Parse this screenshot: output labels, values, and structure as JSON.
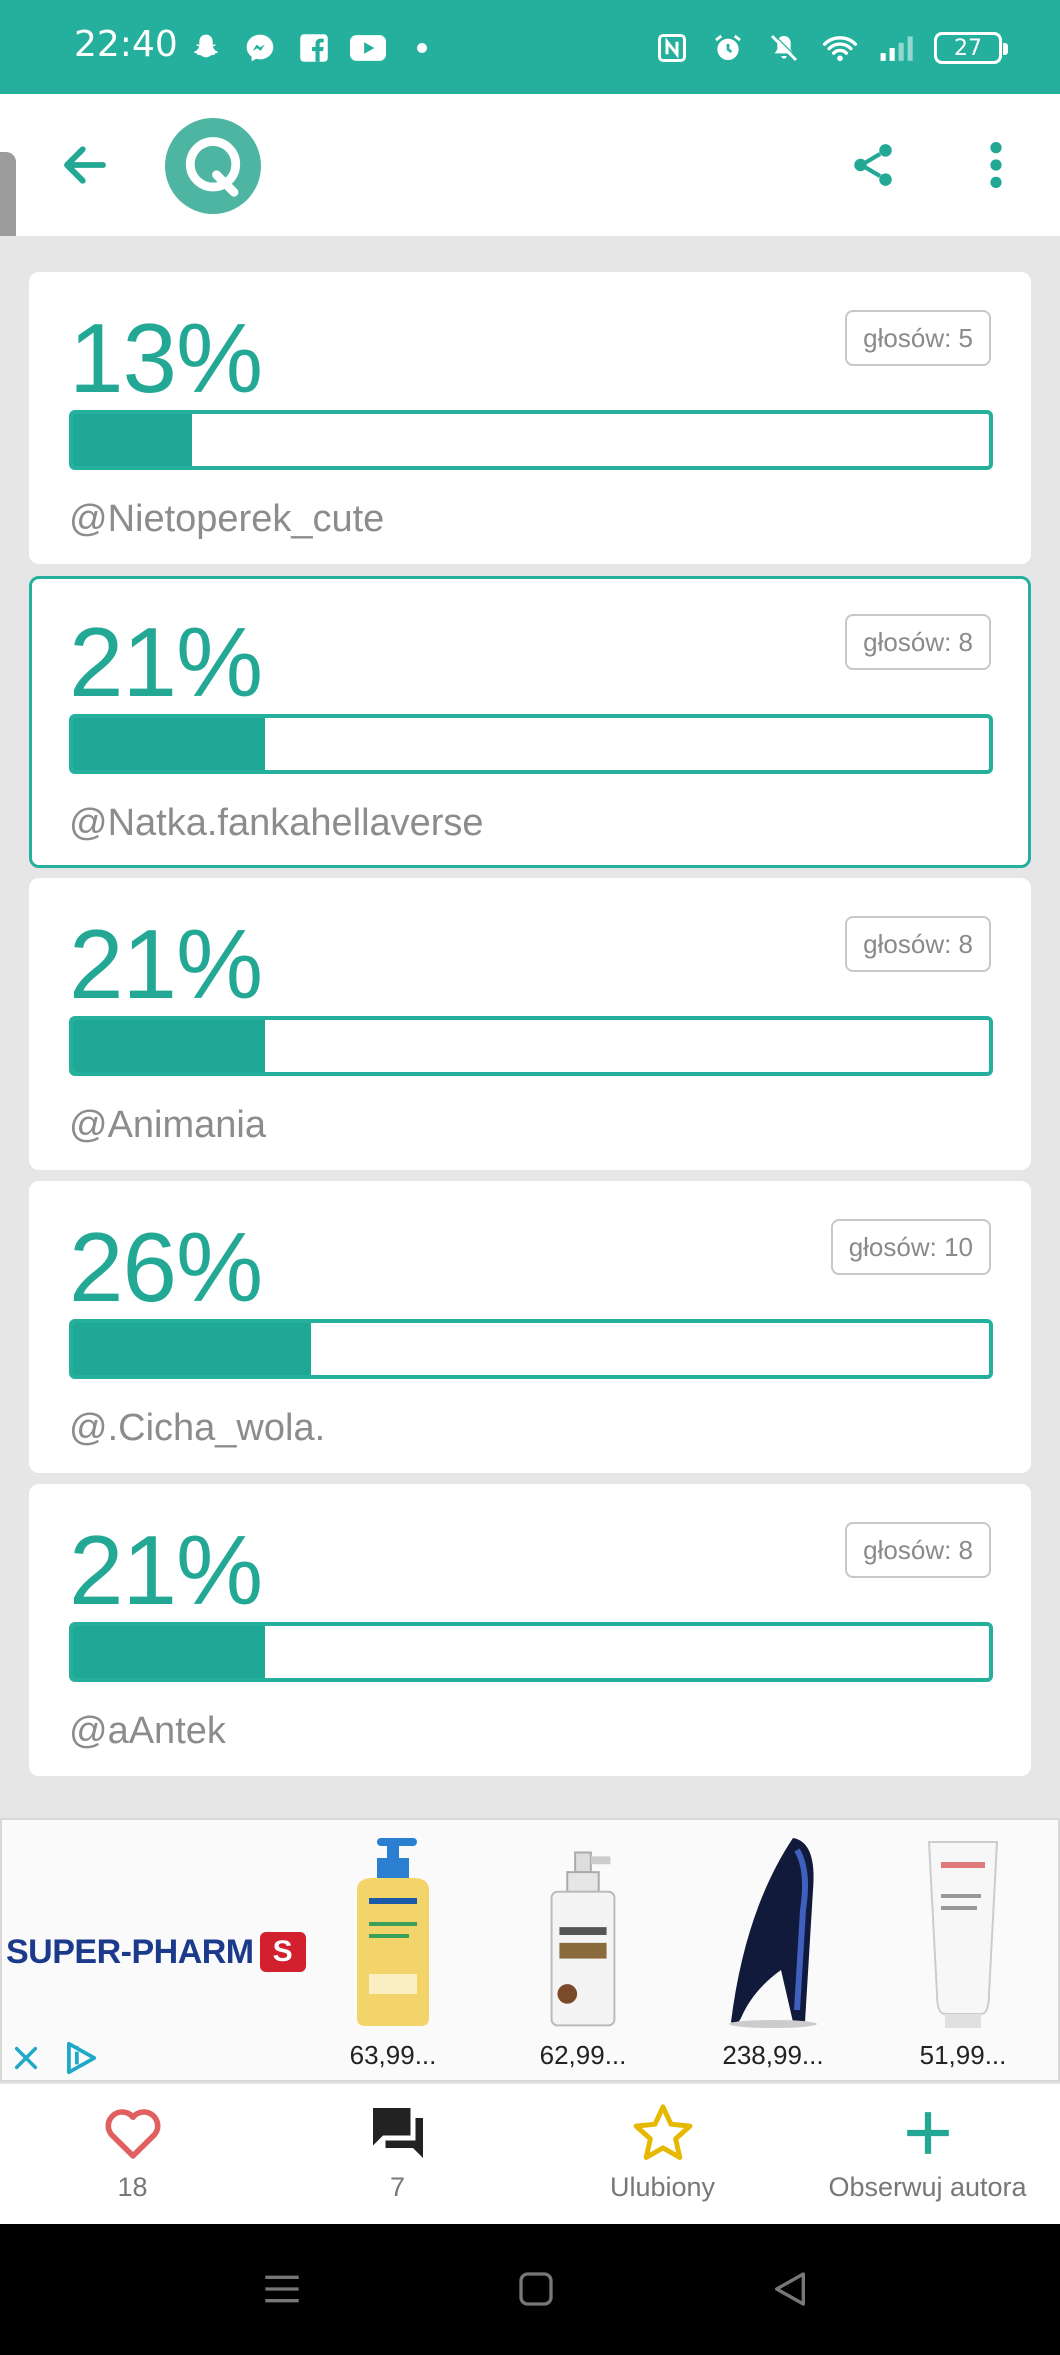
{
  "status_bar": {
    "time": "22:40",
    "battery": "27",
    "icons_left": [
      "snapchat-icon",
      "messenger-icon",
      "facebook-icon",
      "youtube-icon",
      "dot-icon"
    ],
    "icons_right": [
      "nfc-icon",
      "alarm-icon",
      "mute-icon",
      "wifi-icon",
      "signal-icon",
      "battery-icon"
    ],
    "color": "#24b09c"
  },
  "app_bar": {
    "logo_letter": "Q",
    "icons": [
      "arrow-back-icon",
      "share-icon",
      "more-vert-icon"
    ],
    "accent": "#24b09c"
  },
  "poll": {
    "options": [
      {
        "percent_label": "13%",
        "percent": 13,
        "votes_label": "głosów: 5",
        "author": "@Nietoperek_cute",
        "selected": false
      },
      {
        "percent_label": "21%",
        "percent": 21,
        "votes_label": "głosów: 8",
        "author": "@Natka.fankahellaverse",
        "selected": true
      },
      {
        "percent_label": "21%",
        "percent": 21,
        "votes_label": "głosów: 8",
        "author": "@Animania",
        "selected": false
      },
      {
        "percent_label": "26%",
        "percent": 26,
        "votes_label": "głosów: 10",
        "author": "@.Cicha_wola.",
        "selected": false
      },
      {
        "percent_label": "21%",
        "percent": 21,
        "votes_label": "głosów: 8",
        "author": "@aAntek",
        "selected": false
      }
    ]
  },
  "ad": {
    "brand": "SUPER-PHARM",
    "brand_mark": "S",
    "products": [
      {
        "price": "63,99...",
        "icon": "shower-oil-bottle-icon"
      },
      {
        "price": "62,99...",
        "icon": "spray-bottle-icon"
      },
      {
        "price": "238,99...",
        "icon": "perfume-shoe-icon"
      },
      {
        "price": "51,99...",
        "icon": "cream-tube-icon"
      }
    ]
  },
  "actions": {
    "likes": "18",
    "comments": "7",
    "favorite_label": "Ulubiony",
    "follow_label": "Obserwuj autora"
  }
}
